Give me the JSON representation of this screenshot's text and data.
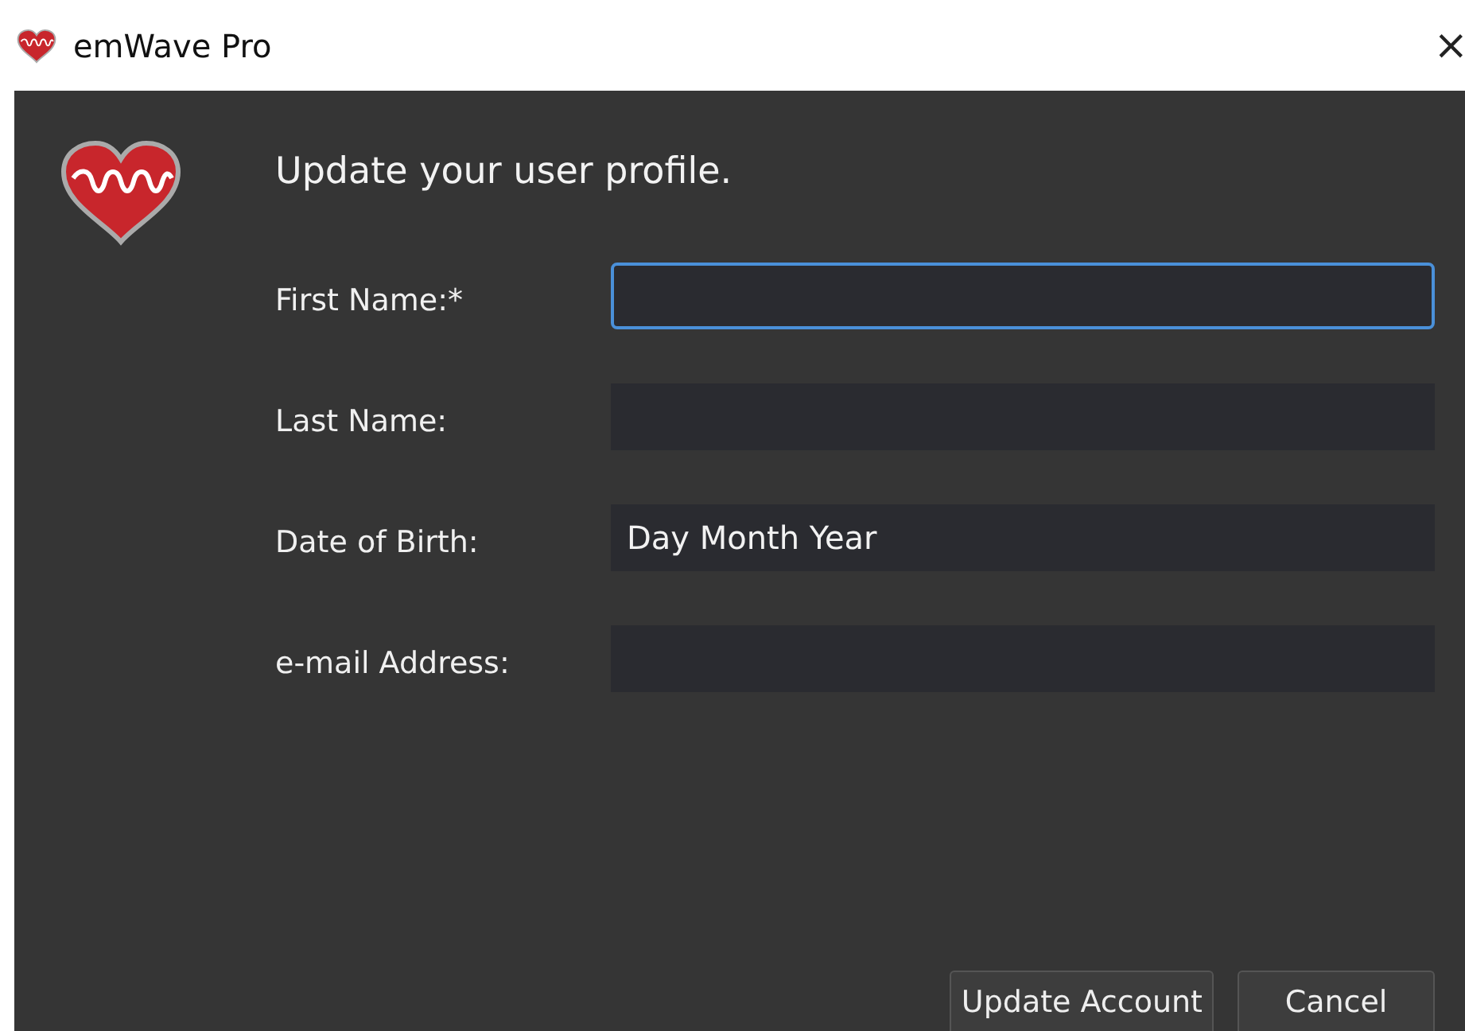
{
  "window": {
    "title": "emWave Pro",
    "close": "×"
  },
  "heading": "Update your user profile.",
  "fields": [
    {
      "label": "First Name:*",
      "focused": true
    },
    {
      "label": "Last Name:",
      "focused": false
    },
    {
      "label": "Date of Birth:",
      "value": "Day Month Year",
      "focused": false
    },
    {
      "label": "e-mail Address:",
      "focused": false
    }
  ],
  "buttons": [
    "Update Account",
    "Cancel"
  ]
}
